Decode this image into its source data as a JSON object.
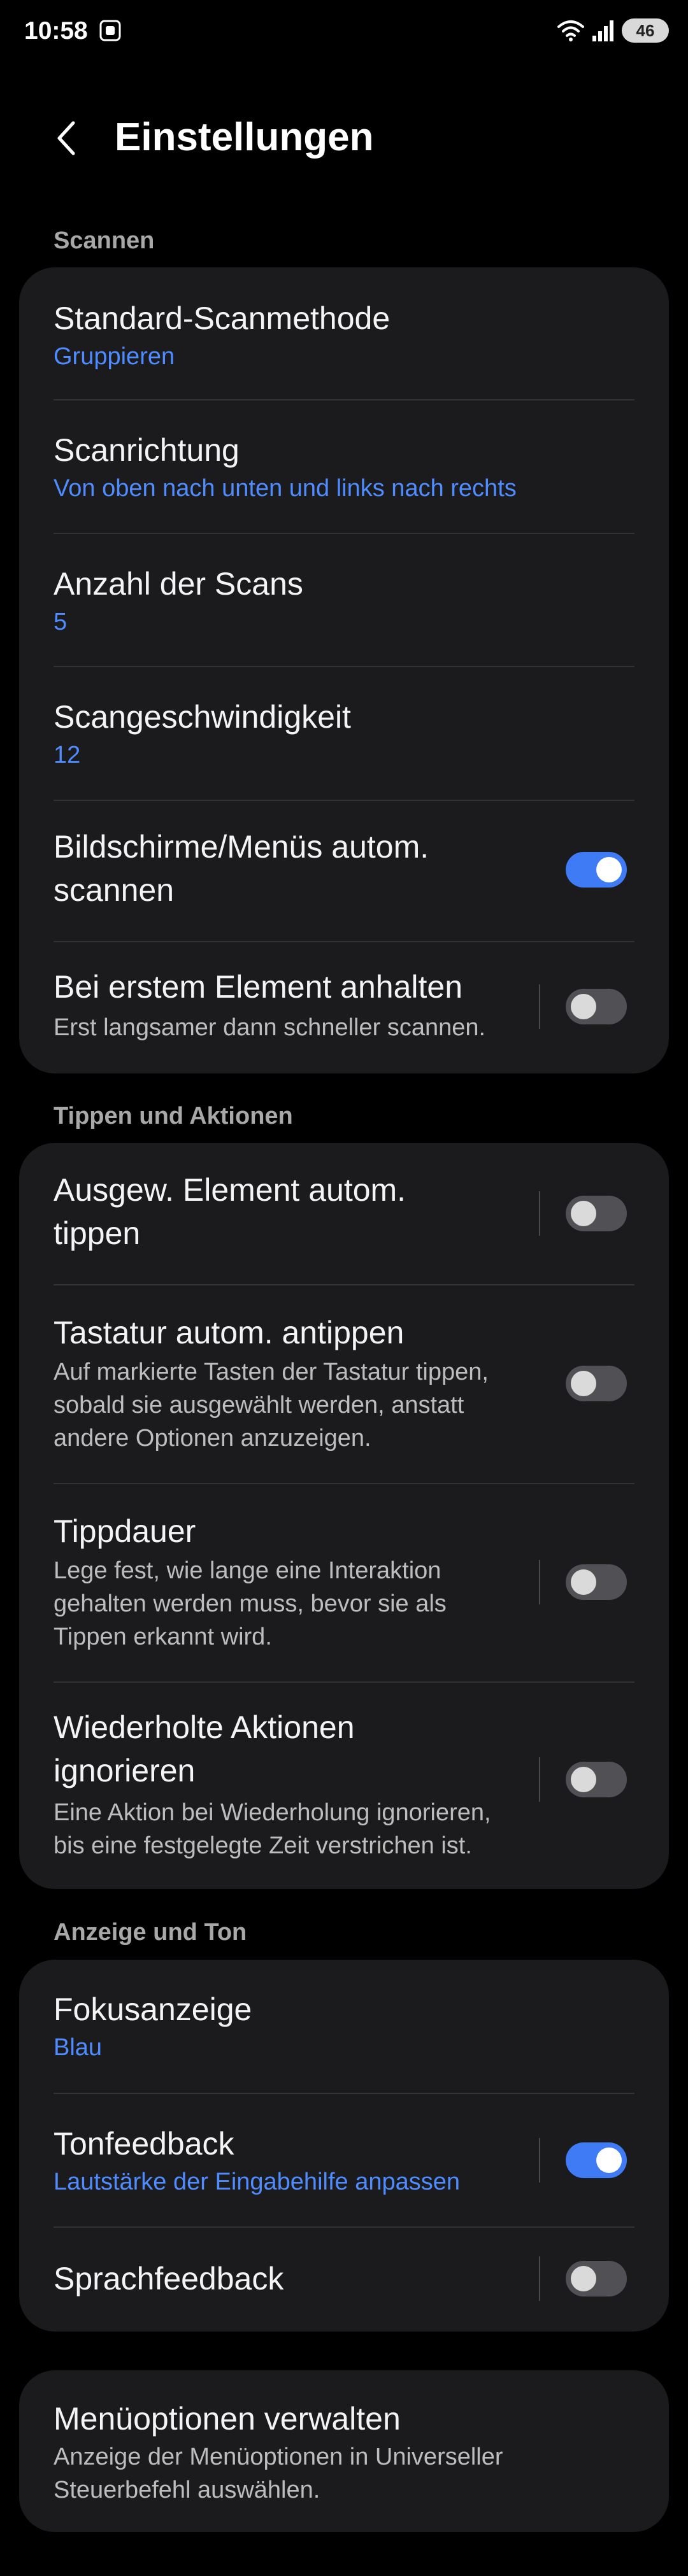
{
  "status_bar": {
    "time": "10:58",
    "cast_icon": "screen-capture-icon",
    "wifi_icon": "wifi-icon",
    "signal_icon": "signal-icon",
    "battery_level": "46"
  },
  "header": {
    "back_icon": "chevron-left-icon",
    "title": "Einstellungen"
  },
  "sections": {
    "scan_label": "Scannen",
    "tap_label": "Tippen und Aktionen",
    "display_label": "Anzeige und Ton"
  },
  "scan": {
    "method_title": "Standard-Scanmethode",
    "method_value": "Gruppieren",
    "direction_title": "Scanrichtung",
    "direction_value": "Von oben nach unten und links nach rechts",
    "count_title": "Anzahl der Scans",
    "count_value": "5",
    "speed_title": "Scangeschwindigkeit",
    "speed_value": "12",
    "auto_screens_title_1": "Bildschirme/Menüs autom.",
    "auto_screens_title_2": "scannen",
    "auto_screens_on": true,
    "pause_first_title": "Bei erstem Element anhalten",
    "pause_first_sub": "Erst langsamer dann schneller scannen.",
    "pause_first_on": false
  },
  "tap": {
    "auto_tap_title_1": "Ausgew. Element autom.",
    "auto_tap_title_2": "tippen",
    "auto_tap_on": false,
    "keyboard_title": "Tastatur autom. antippen",
    "keyboard_sub_1": "Auf markierte Tasten der Tastatur tippen,",
    "keyboard_sub_2": "sobald sie ausgewählt werden, anstatt",
    "keyboard_sub_3": "andere Optionen anzuzeigen.",
    "keyboard_on": false,
    "duration_title": "Tippdauer",
    "duration_sub_1": "Lege fest, wie lange eine Interaktion",
    "duration_sub_2": "gehalten werden muss, bevor sie als",
    "duration_sub_3": "Tippen erkannt wird.",
    "duration_on": false,
    "repeat_title_1": "Wiederholte Aktionen",
    "repeat_title_2": "ignorieren",
    "repeat_sub_1": "Eine Aktion bei Wiederholung ignorieren,",
    "repeat_sub_2": "bis eine festgelegte Zeit verstrichen ist.",
    "repeat_on": false
  },
  "display": {
    "focus_title": "Fokusanzeige",
    "focus_value": "Blau",
    "sound_title": "Tonfeedback",
    "sound_sub": "Lautstärke der Eingabehilfe anpassen",
    "sound_on": true,
    "speech_title": "Sprachfeedback",
    "speech_on": false
  },
  "menu": {
    "title": "Menüoptionen verwalten",
    "sub_1": "Anzeige der Menüoptionen in Universeller",
    "sub_2": "Steuerbefehl auswählen."
  },
  "colors": {
    "background": "#000000",
    "card": "#1b1b1d",
    "accent": "#4f8cff",
    "toggle_on": "#3e7bf5",
    "toggle_off": "#515155"
  }
}
